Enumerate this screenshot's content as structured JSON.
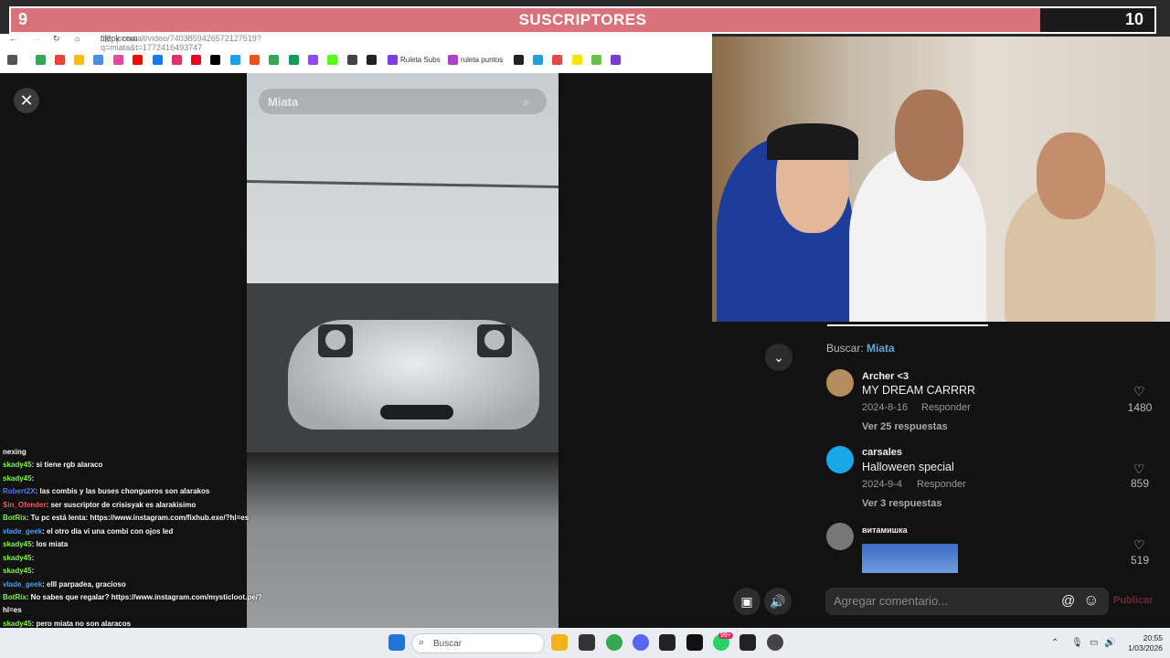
{
  "subscribers": {
    "current": "9",
    "goal": "10",
    "title": "SUSCRIPTORES",
    "progress_fraction": 0.9
  },
  "browser": {
    "nav_back": "←",
    "nav_forward": "→",
    "nav_reload": "↻",
    "nav_home": "⌂",
    "url_host": "tiktok.com",
    "url_path": "/@pyroswall/video/7403859426572127519?q=miata&t=1772416493747",
    "bookmarks": [
      "Ruleta Subs",
      "ruleta puntos"
    ]
  },
  "tiktok": {
    "close_label": "✕",
    "search_value": "Miata",
    "search_icon": "⌕",
    "buscar_label": "Buscar:",
    "buscar_term": "Miata",
    "comments": [
      {
        "user": "Archer <3",
        "text": "MY DREAM CARRRR",
        "date": "2024-8-16",
        "reply": "Responder",
        "more": "Ver 25 respuestas",
        "likes": "1480"
      },
      {
        "user": "carsales",
        "text": "Halloween special",
        "date": "2024-9-4",
        "reply": "Responder",
        "more": "Ver 3 respuestas",
        "likes": "859"
      },
      {
        "user": "витамишка",
        "text": "",
        "date": "",
        "reply": "",
        "more": "",
        "likes": "519"
      }
    ],
    "comment_placeholder": "Agregar comentario...",
    "publish_label": "Publicar",
    "mention_icon": "@",
    "emoji_icon": "☺"
  },
  "chat": [
    {
      "user": "",
      "msg": "nexing",
      "color": "#ffffff"
    },
    {
      "user": "skady45",
      "msg": ": si tiene rgb alaraco",
      "color": "#7cfc3c"
    },
    {
      "user": "skady45",
      "msg": ":",
      "color": "#7cfc3c"
    },
    {
      "user": "Robert2X",
      "msg": ": las combis y las buses chongueros son alarakos",
      "color": "#4f7fff"
    },
    {
      "user": "Sin_Ofender",
      "msg": ": ser suscriptor de crisisyak es alarakisimo",
      "color": "#ff5a5a"
    },
    {
      "user": "BotRix",
      "msg": ": Tu pc está lenta: https://www.instagram.com/fixhub.exe/?hl=es",
      "color": "#7cfc3c"
    },
    {
      "user": "vlade_geek",
      "msg": ": el otro dia vi una combi con ojos led",
      "color": "#3fa9ff"
    },
    {
      "user": "skady45",
      "msg": ": los miata",
      "color": "#7cfc3c"
    },
    {
      "user": "skady45",
      "msg": ":",
      "color": "#7cfc3c"
    },
    {
      "user": "skady45",
      "msg": ":",
      "color": "#7cfc3c"
    },
    {
      "user": "vlade_geek",
      "msg": ": elll parpadea, gracioso",
      "color": "#3fa9ff"
    },
    {
      "user": "BotRix",
      "msg": ": No sabes que regalar? https://www.instagram.com/mysticloot.pe/?",
      "color": "#7cfc3c"
    },
    {
      "user": "",
      "msg": "hl=es",
      "color": "#ffffff"
    },
    {
      "user": "skady45",
      "msg": ": pero miata no son alaracos",
      "color": "#7cfc3c"
    },
    {
      "user": "skady45",
      "msg": "",
      "color": "#7cfc3c"
    },
    {
      "user": "skady45",
      "msg": "",
      "color": "#7cfc3c"
    }
  ],
  "taskbar": {
    "search_placeholder": "Buscar",
    "badge": "99+",
    "time": "20:55",
    "date": "1/03/2026"
  }
}
